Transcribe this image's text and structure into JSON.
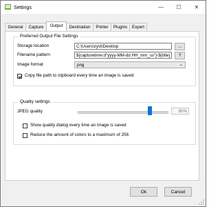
{
  "window": {
    "title": "Settings",
    "minimize_glyph": "—",
    "maximize_glyph": "☐",
    "close_glyph": "✕"
  },
  "tabs": [
    {
      "label": "General",
      "active": false
    },
    {
      "label": "Capture",
      "active": false
    },
    {
      "label": "Output",
      "active": true
    },
    {
      "label": "Destination",
      "active": false
    },
    {
      "label": "Printer",
      "active": false
    },
    {
      "label": "Plugins",
      "active": false
    },
    {
      "label": "Expert",
      "active": false
    }
  ],
  "output_group": {
    "title": "Preferred Output File Settings",
    "storage_location": {
      "label": "Storage location",
      "value": "C:\\Users\\zyst\\Desktop",
      "browse_label": "..."
    },
    "filename_pattern": {
      "label": "Filename pattern",
      "value": "${capturetime:d\"yyyy-MM-dd HH_mm_ss\"}-${title}",
      "help_label": "?"
    },
    "image_format": {
      "label": "Image format",
      "value": "png"
    },
    "copy_path": {
      "label": "Copy file path to clipboard every time an image is saved",
      "checked": true
    }
  },
  "quality_group": {
    "title": "Quality settings",
    "jpeg_quality": {
      "label": "JPEG quality",
      "value_text": "80%",
      "value": 80
    },
    "show_dialog": {
      "label": "Show quality dialog every time an image is saved",
      "checked": false
    },
    "reduce_colors": {
      "label": "Reduce the amount of colors to a maximum of 256",
      "checked": false
    }
  },
  "buttons": {
    "ok": "Ok",
    "cancel": "Cancel"
  },
  "colors": {
    "accent": "#0a74da"
  }
}
